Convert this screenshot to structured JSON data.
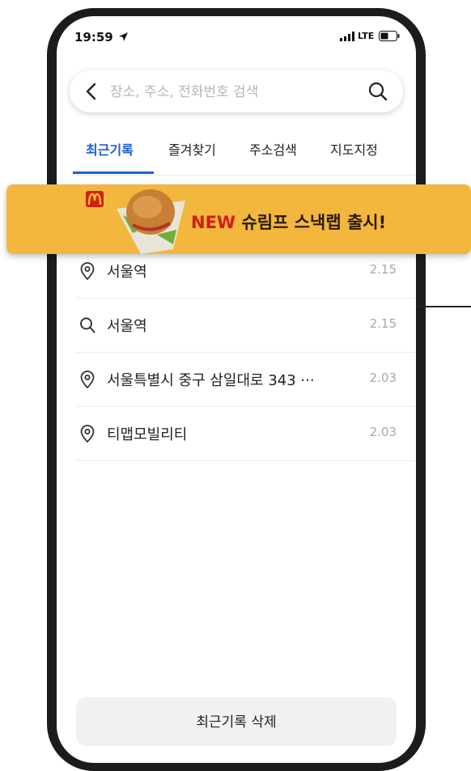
{
  "status_bar": {
    "time": "19:59",
    "network": "LTE"
  },
  "search": {
    "placeholder": "장소, 주소, 전화번호 검색"
  },
  "tabs": [
    {
      "label": "최근기록",
      "active": true
    },
    {
      "label": "즐겨찾기",
      "active": false
    },
    {
      "label": "주소검색",
      "active": false
    },
    {
      "label": "지도지정",
      "active": false
    }
  ],
  "recent_items": [
    {
      "icon": "location-pin-icon",
      "label": "서울역",
      "date": "2.15"
    },
    {
      "icon": "search-icon",
      "label": "서울역",
      "date": "2.15"
    },
    {
      "icon": "location-pin-icon",
      "label": "서울특별시 중구 삼일대로 343 ···",
      "date": "2.03"
    },
    {
      "icon": "location-pin-icon",
      "label": "티맵모빌리티",
      "date": "2.03"
    }
  ],
  "delete_button": {
    "label": "최근기록 삭제"
  },
  "ad_banner": {
    "highlight": "NEW",
    "text": "슈림프 스낵랩 출시!",
    "logo": "M"
  },
  "colors": {
    "accent": "#1a5fd6",
    "ad_background": "#f2b73c",
    "ad_highlight": "#d31c17"
  }
}
